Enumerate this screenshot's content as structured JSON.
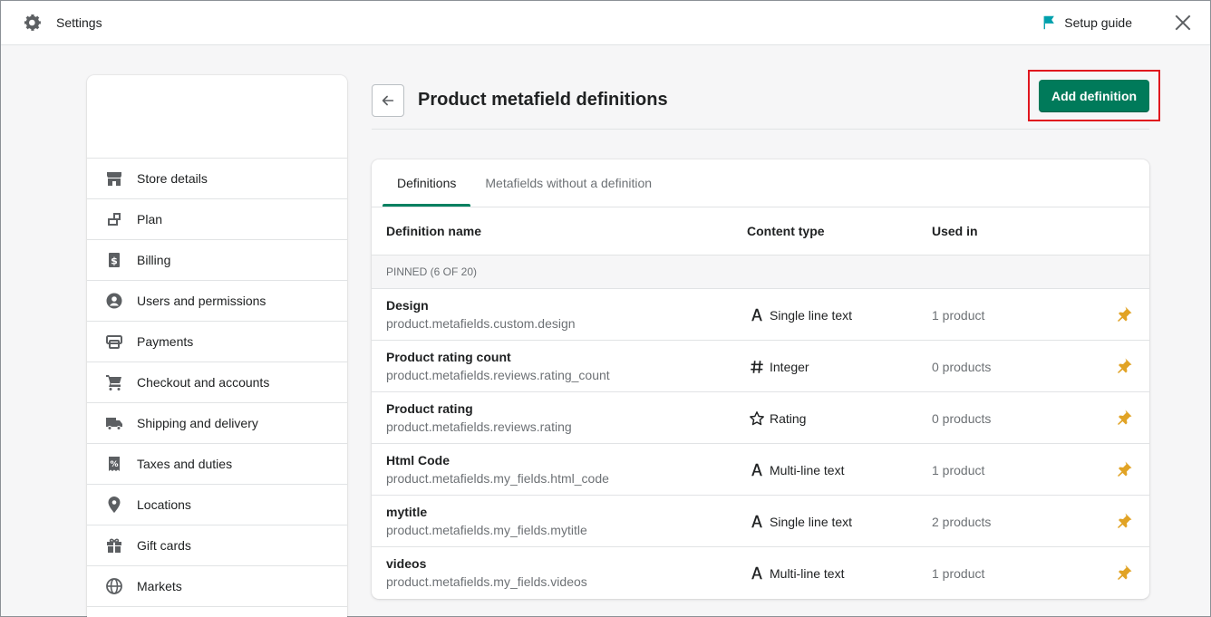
{
  "topbar": {
    "title": "Settings",
    "setup_guide_label": "Setup guide"
  },
  "sidebar": {
    "items": [
      {
        "label": "Store details",
        "icon": "store-icon"
      },
      {
        "label": "Plan",
        "icon": "plan-icon"
      },
      {
        "label": "Billing",
        "icon": "billing-icon"
      },
      {
        "label": "Users and permissions",
        "icon": "user-icon"
      },
      {
        "label": "Payments",
        "icon": "payments-icon"
      },
      {
        "label": "Checkout and accounts",
        "icon": "cart-icon"
      },
      {
        "label": "Shipping and delivery",
        "icon": "truck-icon"
      },
      {
        "label": "Taxes and duties",
        "icon": "tax-icon"
      },
      {
        "label": "Locations",
        "icon": "location-icon"
      },
      {
        "label": "Gift cards",
        "icon": "gift-icon"
      },
      {
        "label": "Markets",
        "icon": "globe-icon"
      }
    ]
  },
  "main": {
    "title": "Product metafield definitions",
    "add_button_label": "Add definition",
    "tabs": [
      {
        "label": "Definitions"
      },
      {
        "label": "Metafields without a definition"
      }
    ],
    "columns": {
      "name": "Definition name",
      "type": "Content type",
      "used": "Used in"
    },
    "group_label": "PINNED (6 OF 20)",
    "rows": [
      {
        "name": "Design",
        "key": "product.metafields.custom.design",
        "type": "Single line text",
        "type_icon": "text-icon",
        "used": "1 product"
      },
      {
        "name": "Product rating count",
        "key": "product.metafields.reviews.rating_count",
        "type": "Integer",
        "type_icon": "hash-icon",
        "used": "0 products"
      },
      {
        "name": "Product rating",
        "key": "product.metafields.reviews.rating",
        "type": "Rating",
        "type_icon": "star-icon",
        "used": "0 products"
      },
      {
        "name": "Html Code",
        "key": "product.metafields.my_fields.html_code",
        "type": "Multi-line text",
        "type_icon": "text-icon",
        "used": "1 product"
      },
      {
        "name": "mytitle",
        "key": "product.metafields.my_fields.mytitle",
        "type": "Single line text",
        "type_icon": "text-icon",
        "used": "2 products"
      },
      {
        "name": "videos",
        "key": "product.metafields.my_fields.videos",
        "type": "Multi-line text",
        "type_icon": "text-icon",
        "used": "1 product"
      }
    ]
  },
  "colors": {
    "primary": "#007a5a",
    "highlight": "#e0161e",
    "pin": "#e1a325",
    "flag": "#00a0ac"
  }
}
